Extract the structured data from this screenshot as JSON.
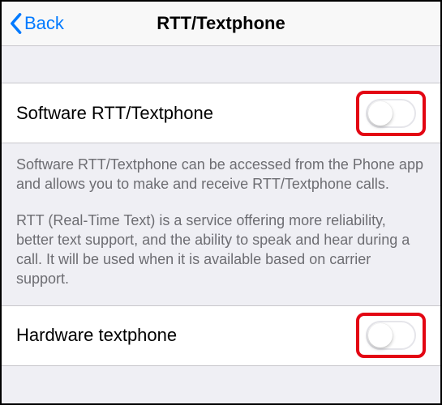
{
  "nav": {
    "back_label": "Back",
    "title": "RTT/Textphone"
  },
  "rows": {
    "software": {
      "label": "Software RTT/Textphone",
      "on": false
    },
    "hardware": {
      "label": "Hardware textphone",
      "on": false
    }
  },
  "explain": {
    "p1": "Software RTT/Textphone can be accessed from the Phone app and allows you to make and receive RTT/Textphone calls.",
    "p2": "RTT (Real-Time Text) is a service offering more reliability, better text support, and the ability to speak and hear during a call. It will be used when it is available based on carrier support."
  }
}
